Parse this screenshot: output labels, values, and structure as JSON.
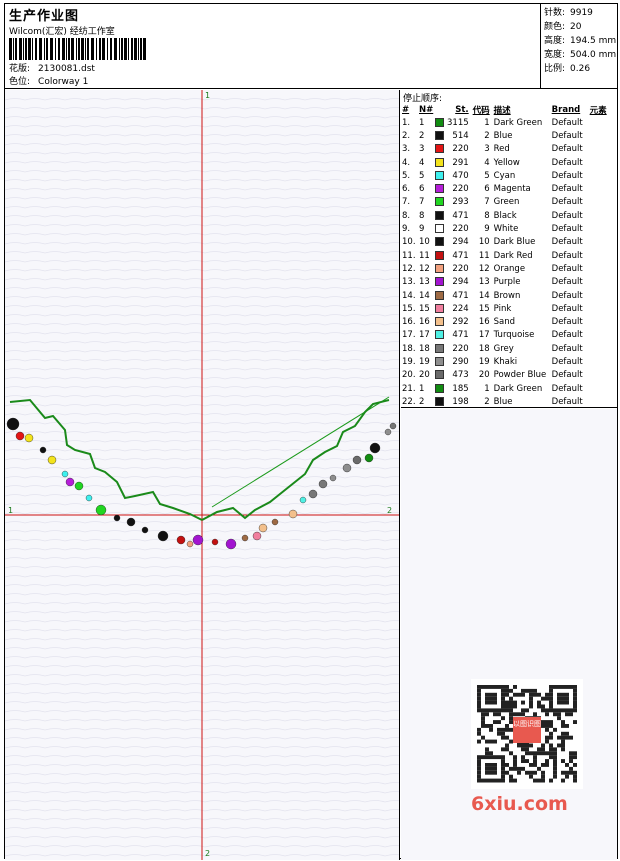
{
  "header": {
    "title": "生产作业图",
    "company": "Wilcom(汇宏) 经纺工作室",
    "design_label": "花版:",
    "design_value": "2130081.dst",
    "colorway_label": "色位:",
    "colorway_value": "Colorway 1"
  },
  "stats": [
    {
      "label": "针数:",
      "value": "9919"
    },
    {
      "label": "颜色:",
      "value": "20"
    },
    {
      "label": "高度:",
      "value": "194.5 mm"
    },
    {
      "label": "宽度:",
      "value": "504.0 mm"
    },
    {
      "label": "比例:",
      "value": "0.26"
    }
  ],
  "axes": {
    "top": "1",
    "bottom": "2",
    "left": "1",
    "right": "2"
  },
  "table": {
    "title": "停止顺序:",
    "headers": [
      "#",
      "N#",
      "St.",
      "代码",
      "描述",
      "Brand",
      "元素"
    ],
    "rows": [
      {
        "idx": "1.",
        "n": "1",
        "color": "#118c11",
        "st": "3115",
        "code": "1",
        "desc": "Dark Green",
        "brand": "Default"
      },
      {
        "idx": "2.",
        "n": "2",
        "color": "#111111",
        "st": "514",
        "code": "2",
        "desc": "Blue",
        "brand": "Default"
      },
      {
        "idx": "3.",
        "n": "3",
        "color": "#e31414",
        "st": "220",
        "code": "3",
        "desc": "Red",
        "brand": "Default"
      },
      {
        "idx": "4.",
        "n": "4",
        "color": "#f3e31c",
        "st": "291",
        "code": "4",
        "desc": "Yellow",
        "brand": "Default"
      },
      {
        "idx": "5.",
        "n": "5",
        "color": "#3ef0ee",
        "st": "470",
        "code": "5",
        "desc": "Cyan",
        "brand": "Default"
      },
      {
        "idx": "6.",
        "n": "6",
        "color": "#b51ed8",
        "st": "220",
        "code": "6",
        "desc": "Magenta",
        "brand": "Default"
      },
      {
        "idx": "7.",
        "n": "7",
        "color": "#21d621",
        "st": "293",
        "code": "7",
        "desc": "Green",
        "brand": "Default"
      },
      {
        "idx": "8.",
        "n": "8",
        "color": "#111111",
        "st": "471",
        "code": "8",
        "desc": "Black",
        "brand": "Default"
      },
      {
        "idx": "9.",
        "n": "9",
        "color": "#ffffff",
        "st": "220",
        "code": "9",
        "desc": "White",
        "brand": "Default"
      },
      {
        "idx": "10.",
        "n": "10",
        "color": "#111111",
        "st": "294",
        "code": "10",
        "desc": "Dark Blue",
        "brand": "Default"
      },
      {
        "idx": "11.",
        "n": "11",
        "color": "#c31010",
        "st": "471",
        "code": "11",
        "desc": "Dark Red",
        "brand": "Default"
      },
      {
        "idx": "12.",
        "n": "12",
        "color": "#f2a07e",
        "st": "220",
        "code": "12",
        "desc": "Orange",
        "brand": "Default"
      },
      {
        "idx": "13.",
        "n": "13",
        "color": "#a214d0",
        "st": "294",
        "code": "13",
        "desc": "Purple",
        "brand": "Default"
      },
      {
        "idx": "14.",
        "n": "14",
        "color": "#9e6a44",
        "st": "471",
        "code": "14",
        "desc": "Brown",
        "brand": "Default"
      },
      {
        "idx": "15.",
        "n": "15",
        "color": "#f07e9e",
        "st": "224",
        "code": "15",
        "desc": "Pink",
        "brand": "Default"
      },
      {
        "idx": "16.",
        "n": "16",
        "color": "#f3c08c",
        "st": "292",
        "code": "16",
        "desc": "Sand",
        "brand": "Default"
      },
      {
        "idx": "17.",
        "n": "17",
        "color": "#4ff0e4",
        "st": "471",
        "code": "17",
        "desc": "Turquoise",
        "brand": "Default"
      },
      {
        "idx": "18.",
        "n": "18",
        "color": "#777777",
        "st": "220",
        "code": "18",
        "desc": "Grey",
        "brand": "Default"
      },
      {
        "idx": "19.",
        "n": "19",
        "color": "#8e8e8e",
        "st": "290",
        "code": "19",
        "desc": "Khaki",
        "brand": "Default"
      },
      {
        "idx": "20.",
        "n": "20",
        "color": "#6a6a6a",
        "st": "473",
        "code": "20",
        "desc": "Powder Blue",
        "brand": "Default"
      },
      {
        "idx": "21.",
        "n": "1",
        "color": "#118c11",
        "st": "185",
        "code": "1",
        "desc": "Dark Green",
        "brand": "Default"
      },
      {
        "idx": "22.",
        "n": "2",
        "color": "#111111",
        "st": "198",
        "code": "2",
        "desc": "Blue",
        "brand": "Default"
      }
    ]
  },
  "watermark": "6xiu.com",
  "qr_stamp": "以图识图",
  "colors": {
    "axis": "#cc1111",
    "frame": "#000000",
    "canvas_bg": "#f7f7fb",
    "watermark": "#e8594f"
  }
}
